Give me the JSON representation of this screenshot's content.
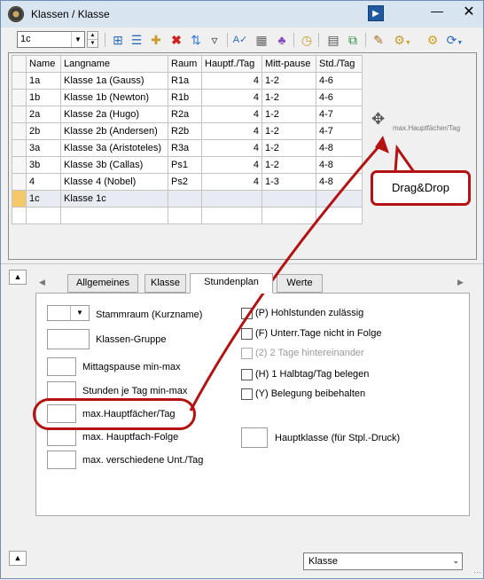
{
  "window": {
    "title": "Klassen / Klasse"
  },
  "toolbar": {
    "class_value": "1c"
  },
  "grid": {
    "columns": [
      "Name",
      "Langname",
      "Raum",
      "Hauptf./Tag",
      "Mitt-pause",
      "Std./Tag"
    ],
    "rows": [
      [
        "1a",
        "Klasse 1a (Gauss)",
        "R1a",
        "4",
        "1-2",
        "4-6"
      ],
      [
        "1b",
        "Klasse 1b (Newton)",
        "R1b",
        "4",
        "1-2",
        "4-6"
      ],
      [
        "2a",
        "Klasse 2a (Hugo)",
        "R2a",
        "4",
        "1-2",
        "4-7"
      ],
      [
        "2b",
        "Klasse 2b (Andersen)",
        "R2b",
        "4",
        "1-2",
        "4-7"
      ],
      [
        "3a",
        "Klasse 3a (Aristoteles)",
        "R3a",
        "4",
        "1-2",
        "4-8"
      ],
      [
        "3b",
        "Klasse 3b (Callas)",
        "Ps1",
        "4",
        "1-2",
        "4-8"
      ],
      [
        "4",
        "Klasse 4 (Nobel)",
        "Ps2",
        "4",
        "1-3",
        "4-8"
      ],
      [
        "1c",
        "Klasse 1c",
        "",
        "",
        "",
        ""
      ]
    ]
  },
  "tabs": [
    "Allgemeines",
    "Klasse",
    "Stundenplan",
    "Werte"
  ],
  "fields": {
    "stammraum": "Stammraum (Kurzname)",
    "klassen_gruppe": "Klassen-Gruppe",
    "mittagspause": "Mittagspause min-max",
    "stunden_je_tag": "Stunden je Tag min-max",
    "max_hauptfaecher": "max.Hauptfächer/Tag",
    "max_hauptfach_folge": "max. Hauptfach-Folge",
    "max_versch_unt": "max. verschiedene Unt./Tag",
    "hauptklasse": "Hauptklasse (für Stpl.-Druck)"
  },
  "checkboxes": [
    {
      "label": "(P) Hohlstunden zulässig",
      "checked": false,
      "disabled": false
    },
    {
      "label": "(F) Unterr.Tage nicht in Folge",
      "checked": false,
      "disabled": false
    },
    {
      "label": "(2) 2 Tage hintereinander",
      "checked": false,
      "disabled": true
    },
    {
      "label": "(H) 1 Halbtag/Tag belegen",
      "checked": false,
      "disabled": false
    },
    {
      "label": "(Y) Belegung beibehalten",
      "checked": false,
      "disabled": false
    }
  ],
  "bottom_select": {
    "value": "Klasse"
  },
  "annotations": {
    "callout": "Drag&Drop",
    "drag_ghost": "max.Hauptfächer/Tag"
  },
  "colors": {
    "annotation_red": "#b51212",
    "selected_row": "#f5c86a"
  },
  "icons": [
    "app-icon",
    "nav-arrow-icon",
    "minimize-icon",
    "close-icon",
    "new-icon",
    "columns-icon",
    "add-icon",
    "delete-icon",
    "sort-icon",
    "filter-icon",
    "spellcheck-icon",
    "grid-icon",
    "link-icon",
    "clock-icon",
    "list-icon",
    "copy-icon",
    "paint-icon",
    "settings-icon",
    "gear-icon",
    "help-icon",
    "move-icon"
  ]
}
